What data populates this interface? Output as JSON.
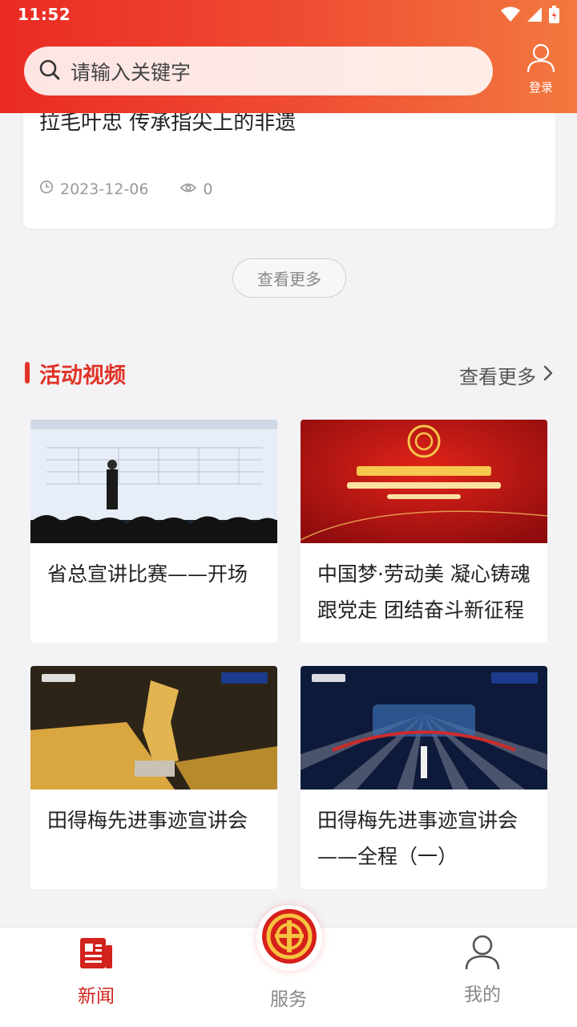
{
  "status": {
    "time": "11:52"
  },
  "search": {
    "placeholder": "请输入关键字"
  },
  "header": {
    "login_label": "登录"
  },
  "news_card": {
    "title": "拉毛叶忠 传承指尖上的非遗",
    "date": "2023-12-06",
    "views": "0"
  },
  "more_button": "查看更多",
  "section": {
    "title": "活动视频",
    "more_label": "查看更多"
  },
  "videos": [
    {
      "title": "省总宣讲比赛——开场"
    },
    {
      "title": "中国梦·劳动美 凝心铸魂跟党走 团结奋斗新征程"
    },
    {
      "title": "田得梅先进事迹宣讲会"
    },
    {
      "title": "田得梅先进事迹宣讲会——全程（一）"
    }
  ],
  "tabs": {
    "news": "新闻",
    "service": "服务",
    "mine": "我的"
  },
  "colors": {
    "accent": "#e03226",
    "header_start": "#ea2a23",
    "header_end": "#f2793f",
    "tab_inactive": "#888888"
  },
  "icons": [
    "search-icon",
    "user-icon",
    "clock-icon",
    "eye-icon",
    "chevron-right-icon",
    "news-icon",
    "union-emblem-icon",
    "person-icon",
    "wifi-icon",
    "signal-icon",
    "battery-icon"
  ]
}
